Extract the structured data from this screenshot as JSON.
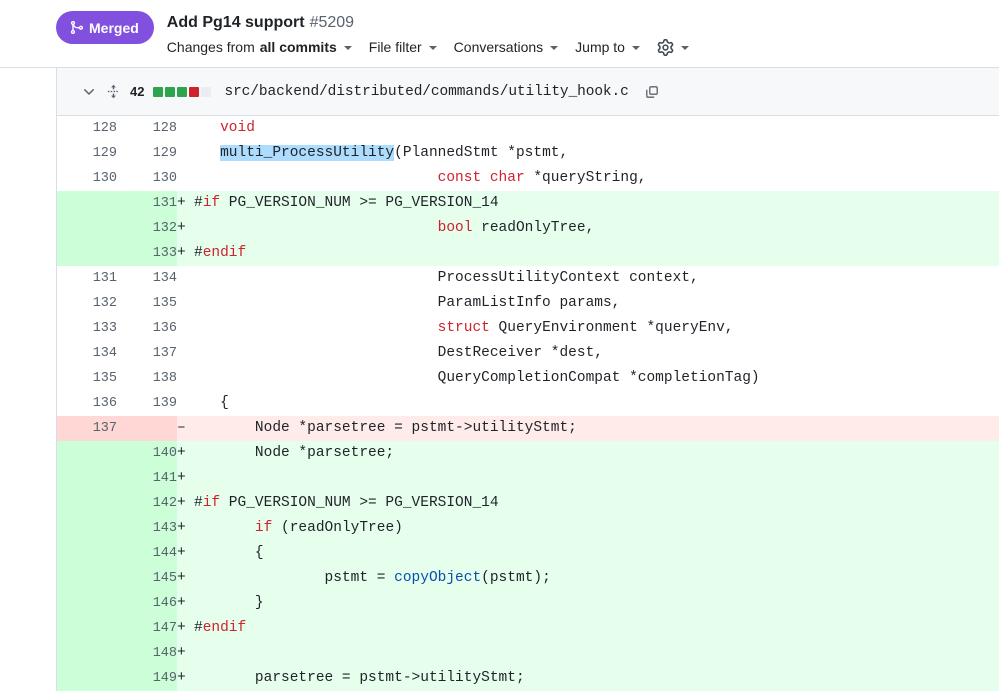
{
  "header": {
    "status_badge": {
      "label": "Merged",
      "icon": "git-merge-icon",
      "color": "#8250df"
    },
    "title": "Add Pg14 support",
    "pr_number": "#5209",
    "toolbar": [
      {
        "name": "changes-from",
        "prefix": "Changes from",
        "strong": "all commits",
        "caret": true
      },
      {
        "name": "file-filter",
        "prefix": "File filter",
        "strong": "",
        "caret": true
      },
      {
        "name": "conversations",
        "prefix": "Conversations",
        "strong": "",
        "caret": true
      },
      {
        "name": "jump-to",
        "prefix": "Jump to",
        "strong": "",
        "caret": true
      },
      {
        "name": "diff-settings",
        "prefix": "",
        "strong": "",
        "icon": "gear-icon",
        "caret": true
      }
    ]
  },
  "file": {
    "collapse_icon": "chevron-down-icon",
    "expand_icon": "unfold-vertical-icon",
    "changes_count": "42",
    "diffstat": [
      "add",
      "add",
      "add",
      "del",
      "none"
    ],
    "path": "src/backend/distributed/commands/utility_hook.c",
    "copy_icon": "copy-icon"
  },
  "diff": {
    "rows": [
      {
        "type": "ctx",
        "old": "128",
        "new": "128",
        "marker": "",
        "tokens": [
          {
            "t": "   ",
            "c": ""
          },
          {
            "t": "void",
            "c": "k"
          }
        ]
      },
      {
        "type": "ctx",
        "old": "129",
        "new": "129",
        "marker": "",
        "tokens": [
          {
            "t": "   ",
            "c": ""
          },
          {
            "t": "multi_ProcessUtility",
            "c": "sel"
          },
          {
            "t": "(PlannedStmt *pstmt,",
            "c": ""
          }
        ]
      },
      {
        "type": "ctx",
        "old": "130",
        "new": "130",
        "marker": "",
        "tokens": [
          {
            "t": "                            ",
            "c": ""
          },
          {
            "t": "const char",
            "c": "k"
          },
          {
            "t": " *queryString,",
            "c": ""
          }
        ]
      },
      {
        "type": "add",
        "old": "",
        "new": "131",
        "marker": "+",
        "tokens": [
          {
            "t": "#",
            "c": ""
          },
          {
            "t": "if",
            "c": "k"
          },
          {
            "t": " PG_VERSION_NUM >= PG_VERSION_14",
            "c": ""
          }
        ]
      },
      {
        "type": "add",
        "old": "",
        "new": "132",
        "marker": "+",
        "tokens": [
          {
            "t": "                            ",
            "c": ""
          },
          {
            "t": "bool",
            "c": "k"
          },
          {
            "t": " readOnlyTree,",
            "c": ""
          }
        ]
      },
      {
        "type": "add",
        "old": "",
        "new": "133",
        "marker": "+",
        "tokens": [
          {
            "t": "#",
            "c": ""
          },
          {
            "t": "endif",
            "c": "k"
          }
        ]
      },
      {
        "type": "ctx",
        "old": "131",
        "new": "134",
        "marker": "",
        "tokens": [
          {
            "t": "                            ProcessUtilityContext context,",
            "c": ""
          }
        ]
      },
      {
        "type": "ctx",
        "old": "132",
        "new": "135",
        "marker": "",
        "tokens": [
          {
            "t": "                            ParamListInfo params,",
            "c": ""
          }
        ]
      },
      {
        "type": "ctx",
        "old": "133",
        "new": "136",
        "marker": "",
        "tokens": [
          {
            "t": "                            ",
            "c": ""
          },
          {
            "t": "struct",
            "c": "k"
          },
          {
            "t": " QueryEnvironment *queryEnv,",
            "c": ""
          }
        ]
      },
      {
        "type": "ctx",
        "old": "134",
        "new": "137",
        "marker": "",
        "tokens": [
          {
            "t": "                            DestReceiver *dest,",
            "c": ""
          }
        ]
      },
      {
        "type": "ctx",
        "old": "135",
        "new": "138",
        "marker": "",
        "tokens": [
          {
            "t": "                            QueryCompletionCompat *completionTag)",
            "c": ""
          }
        ]
      },
      {
        "type": "ctx",
        "old": "136",
        "new": "139",
        "marker": "",
        "tokens": [
          {
            "t": "   {",
            "c": ""
          }
        ]
      },
      {
        "type": "del",
        "old": "137",
        "new": "",
        "marker": "–",
        "tokens": [
          {
            "t": "       Node *parsetree = pstmt->utilityStmt;",
            "c": ""
          }
        ]
      },
      {
        "type": "add",
        "old": "",
        "new": "140",
        "marker": "+",
        "tokens": [
          {
            "t": "       Node *parsetree;",
            "c": ""
          }
        ]
      },
      {
        "type": "add",
        "old": "",
        "new": "141",
        "marker": "+",
        "tokens": [
          {
            "t": "",
            "c": ""
          }
        ]
      },
      {
        "type": "add",
        "old": "",
        "new": "142",
        "marker": "+",
        "tokens": [
          {
            "t": "#",
            "c": ""
          },
          {
            "t": "if",
            "c": "k"
          },
          {
            "t": " PG_VERSION_NUM >= PG_VERSION_14",
            "c": ""
          }
        ]
      },
      {
        "type": "add",
        "old": "",
        "new": "143",
        "marker": "+",
        "tokens": [
          {
            "t": "       ",
            "c": ""
          },
          {
            "t": "if",
            "c": "k"
          },
          {
            "t": " (readOnlyTree)",
            "c": ""
          }
        ]
      },
      {
        "type": "add",
        "old": "",
        "new": "144",
        "marker": "+",
        "tokens": [
          {
            "t": "       {",
            "c": ""
          }
        ]
      },
      {
        "type": "add",
        "old": "",
        "new": "145",
        "marker": "+",
        "tokens": [
          {
            "t": "               pstmt = ",
            "c": ""
          },
          {
            "t": "copyObject",
            "c": "fn"
          },
          {
            "t": "(pstmt);",
            "c": ""
          }
        ]
      },
      {
        "type": "add",
        "old": "",
        "new": "146",
        "marker": "+",
        "tokens": [
          {
            "t": "       }",
            "c": ""
          }
        ]
      },
      {
        "type": "add",
        "old": "",
        "new": "147",
        "marker": "+",
        "tokens": [
          {
            "t": "#",
            "c": ""
          },
          {
            "t": "endif",
            "c": "k"
          }
        ]
      },
      {
        "type": "add",
        "old": "",
        "new": "148",
        "marker": "+",
        "tokens": [
          {
            "t": "",
            "c": ""
          }
        ]
      },
      {
        "type": "add",
        "old": "",
        "new": "149",
        "marker": "+",
        "tokens": [
          {
            "t": "       parsetree = pstmt->utilityStmt;",
            "c": ""
          }
        ]
      }
    ]
  }
}
